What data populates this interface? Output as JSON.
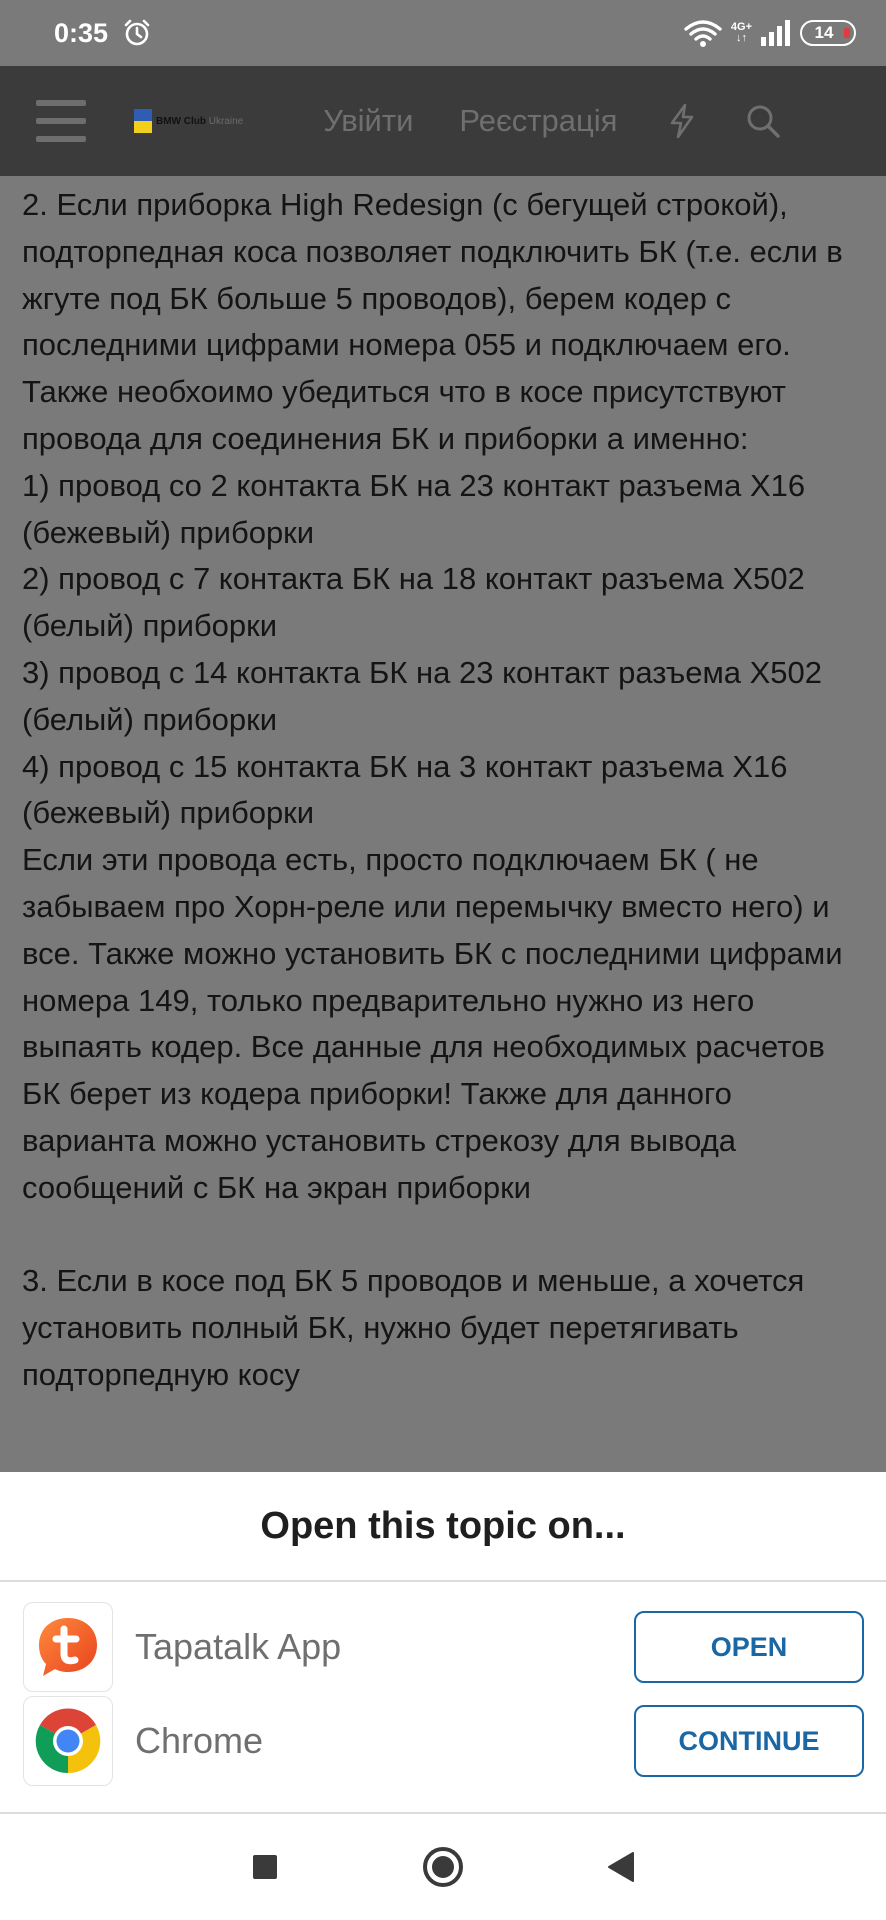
{
  "status_bar": {
    "time": "0:35",
    "network_top": "4G+",
    "network_bottom": "↓↑",
    "battery": "14"
  },
  "header": {
    "logo_text": "BMW Club",
    "logo_sub": "Ukraine",
    "login_label": "Увійти",
    "register_label": "Реєстрація"
  },
  "content": {
    "text": "2. Если приборка High Redesign (с бегущей строкой), подторпедная коса позволяет подключить БК (т.е. если в жгуте под БК больше 5 проводов), берем кодер с последними цифрами номера 055 и подключаем его. Также необхоимо убедиться что в косе присутствуют провода для соединения БК и приборки а именно:\n1) провод со 2 контакта БК на 23 контакт разъема X16 (бежевый) приборки\n2) провод с 7 контакта БК на 18 контакт разъема X502 (белый) приборки\n3) провод с 14 контакта БК на 23 контакт разъема X502 (белый) приборки\n4) провод с 15 контакта БК на 3 контакт разъема X16 (бежевый) приборки\nЕсли эти провода есть, просто подключаем БК ( не забываем про Хорн-реле или перемычку вместо него) и все. Также можно установить БК с последними цифрами номера 149, только предварительно нужно из него выпаять кодер. Все данные для необходимых расчетов БК берет из кодера приборки! Также для данного варианта можно установить стрекозу для вывода сообщений с БК на экран приборки\n\n3. Если в косе под БК 5 проводов и меньше, а хочется установить полный БК, нужно будет перетягивать подторпедную косу"
  },
  "sheet": {
    "title": "Open this topic on...",
    "apps": [
      {
        "name": "Tapatalk App",
        "button": "OPEN",
        "icon": "tapatalk-icon"
      },
      {
        "name": "Chrome",
        "button": "CONTINUE",
        "icon": "chrome-icon"
      }
    ]
  },
  "colors": {
    "accent": "#1a67a6",
    "header_bg": "#3b3b3b",
    "dim_bg": "#7a7a7a"
  }
}
